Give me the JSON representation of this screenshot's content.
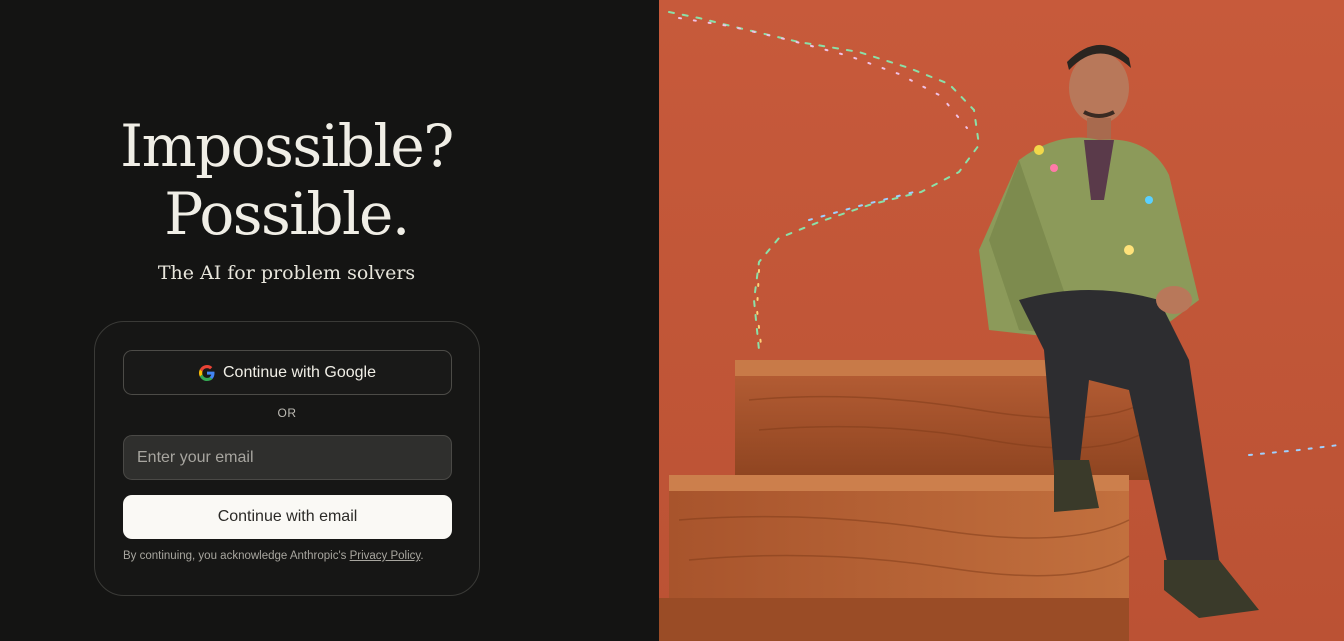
{
  "hero": {
    "line1": "Impossible?",
    "line2": "Possible.",
    "tagline": "The AI for problem solvers"
  },
  "login": {
    "google_label": "Continue with Google",
    "or_label": "OR",
    "email_placeholder": "Enter your email",
    "email_button_label": "Continue with email",
    "legal_prefix": "By continuing, you acknowledge Anthropic's ",
    "privacy_link": "Privacy Policy",
    "legal_suffix": "."
  },
  "illustration": {
    "icon": "hero-photo-person-on-wooden-steps",
    "background_color": "#c3583a"
  },
  "colors": {
    "page_background": "#141413",
    "primary_button": "#faf9f5"
  }
}
